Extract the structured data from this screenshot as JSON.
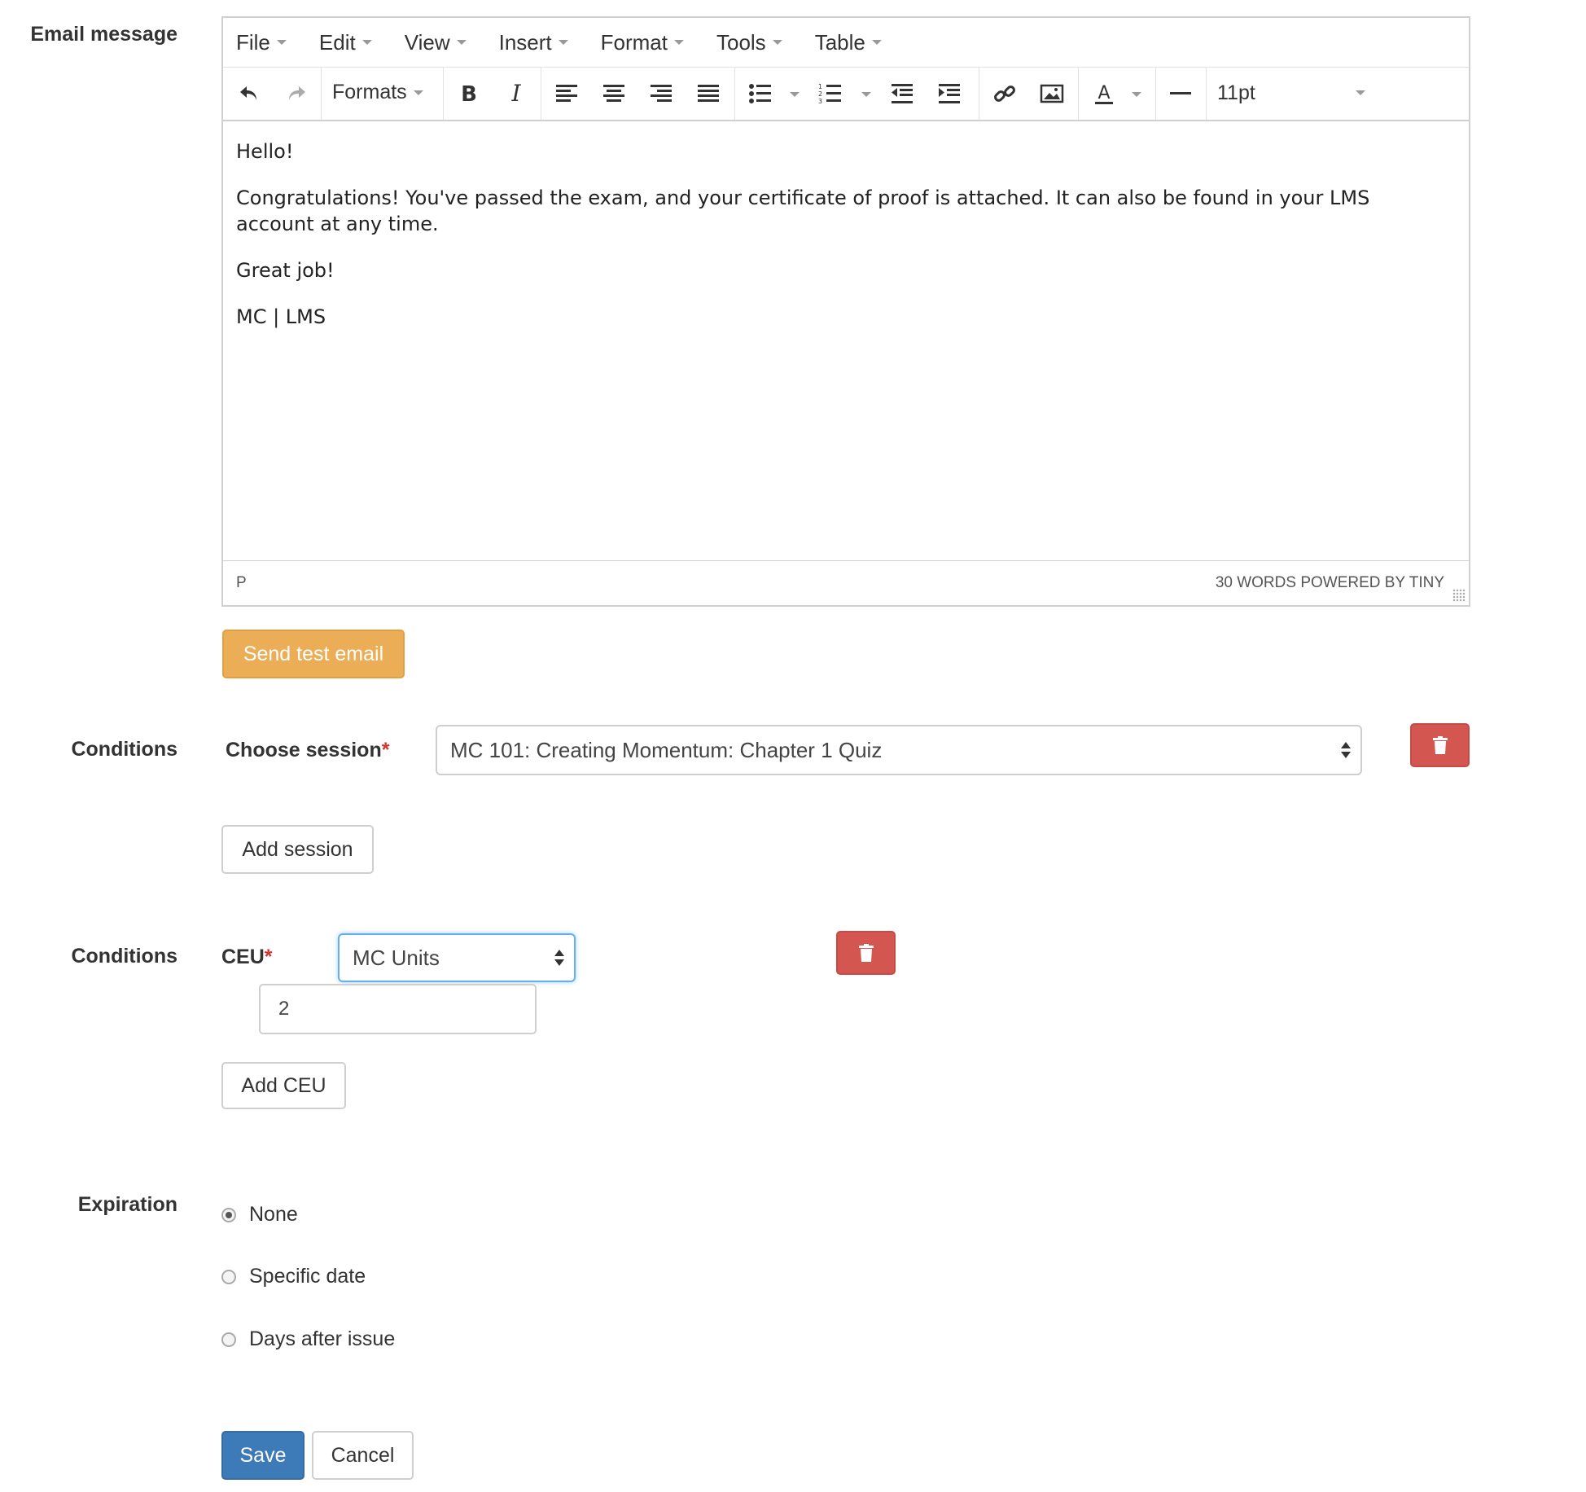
{
  "email": {
    "label": "Email message",
    "menu": [
      "File",
      "Edit",
      "View",
      "Insert",
      "Format",
      "Tools",
      "Table"
    ],
    "toolbar": {
      "formats_label": "Formats",
      "font_size": "11pt",
      "icons": [
        "undo-icon",
        "redo-icon",
        "bold-icon",
        "italic-icon",
        "align-left-icon",
        "align-center-icon",
        "align-right-icon",
        "align-justify-icon",
        "bullet-list-icon",
        "numbered-list-icon",
        "outdent-icon",
        "indent-icon",
        "link-icon",
        "image-icon",
        "text-color-icon",
        "horizontal-rule-icon"
      ]
    },
    "body": {
      "p1": "Hello!",
      "p2": "Congratulations! You've passed the exam, and your certificate of proof is attached. It can also be found in your LMS account at any time.",
      "p3": "Great job!",
      "p4": "MC | LMS"
    },
    "status": {
      "path": "P",
      "words": "30 WORDS POWERED BY TINY"
    },
    "send_test_label": "Send test email"
  },
  "conditions_session": {
    "label": "Conditions",
    "field_label": "Choose session",
    "required_mark": "*",
    "selected": "MC 101: Creating Momentum: Chapter 1 Quiz",
    "add_label": "Add session"
  },
  "conditions_ceu": {
    "label": "Conditions",
    "field_label": "CEU",
    "required_mark": "*",
    "selected": "MC Units",
    "value": "2",
    "add_label": "Add CEU"
  },
  "expiration": {
    "label": "Expiration",
    "options": [
      "None",
      "Specific date",
      "Days after issue"
    ],
    "selected": "None"
  },
  "actions": {
    "save_label": "Save",
    "cancel_label": "Cancel"
  },
  "colors": {
    "warning": "#ebad56",
    "danger": "#d35651",
    "primary": "#3d7ab8",
    "required": "#d0342c"
  }
}
